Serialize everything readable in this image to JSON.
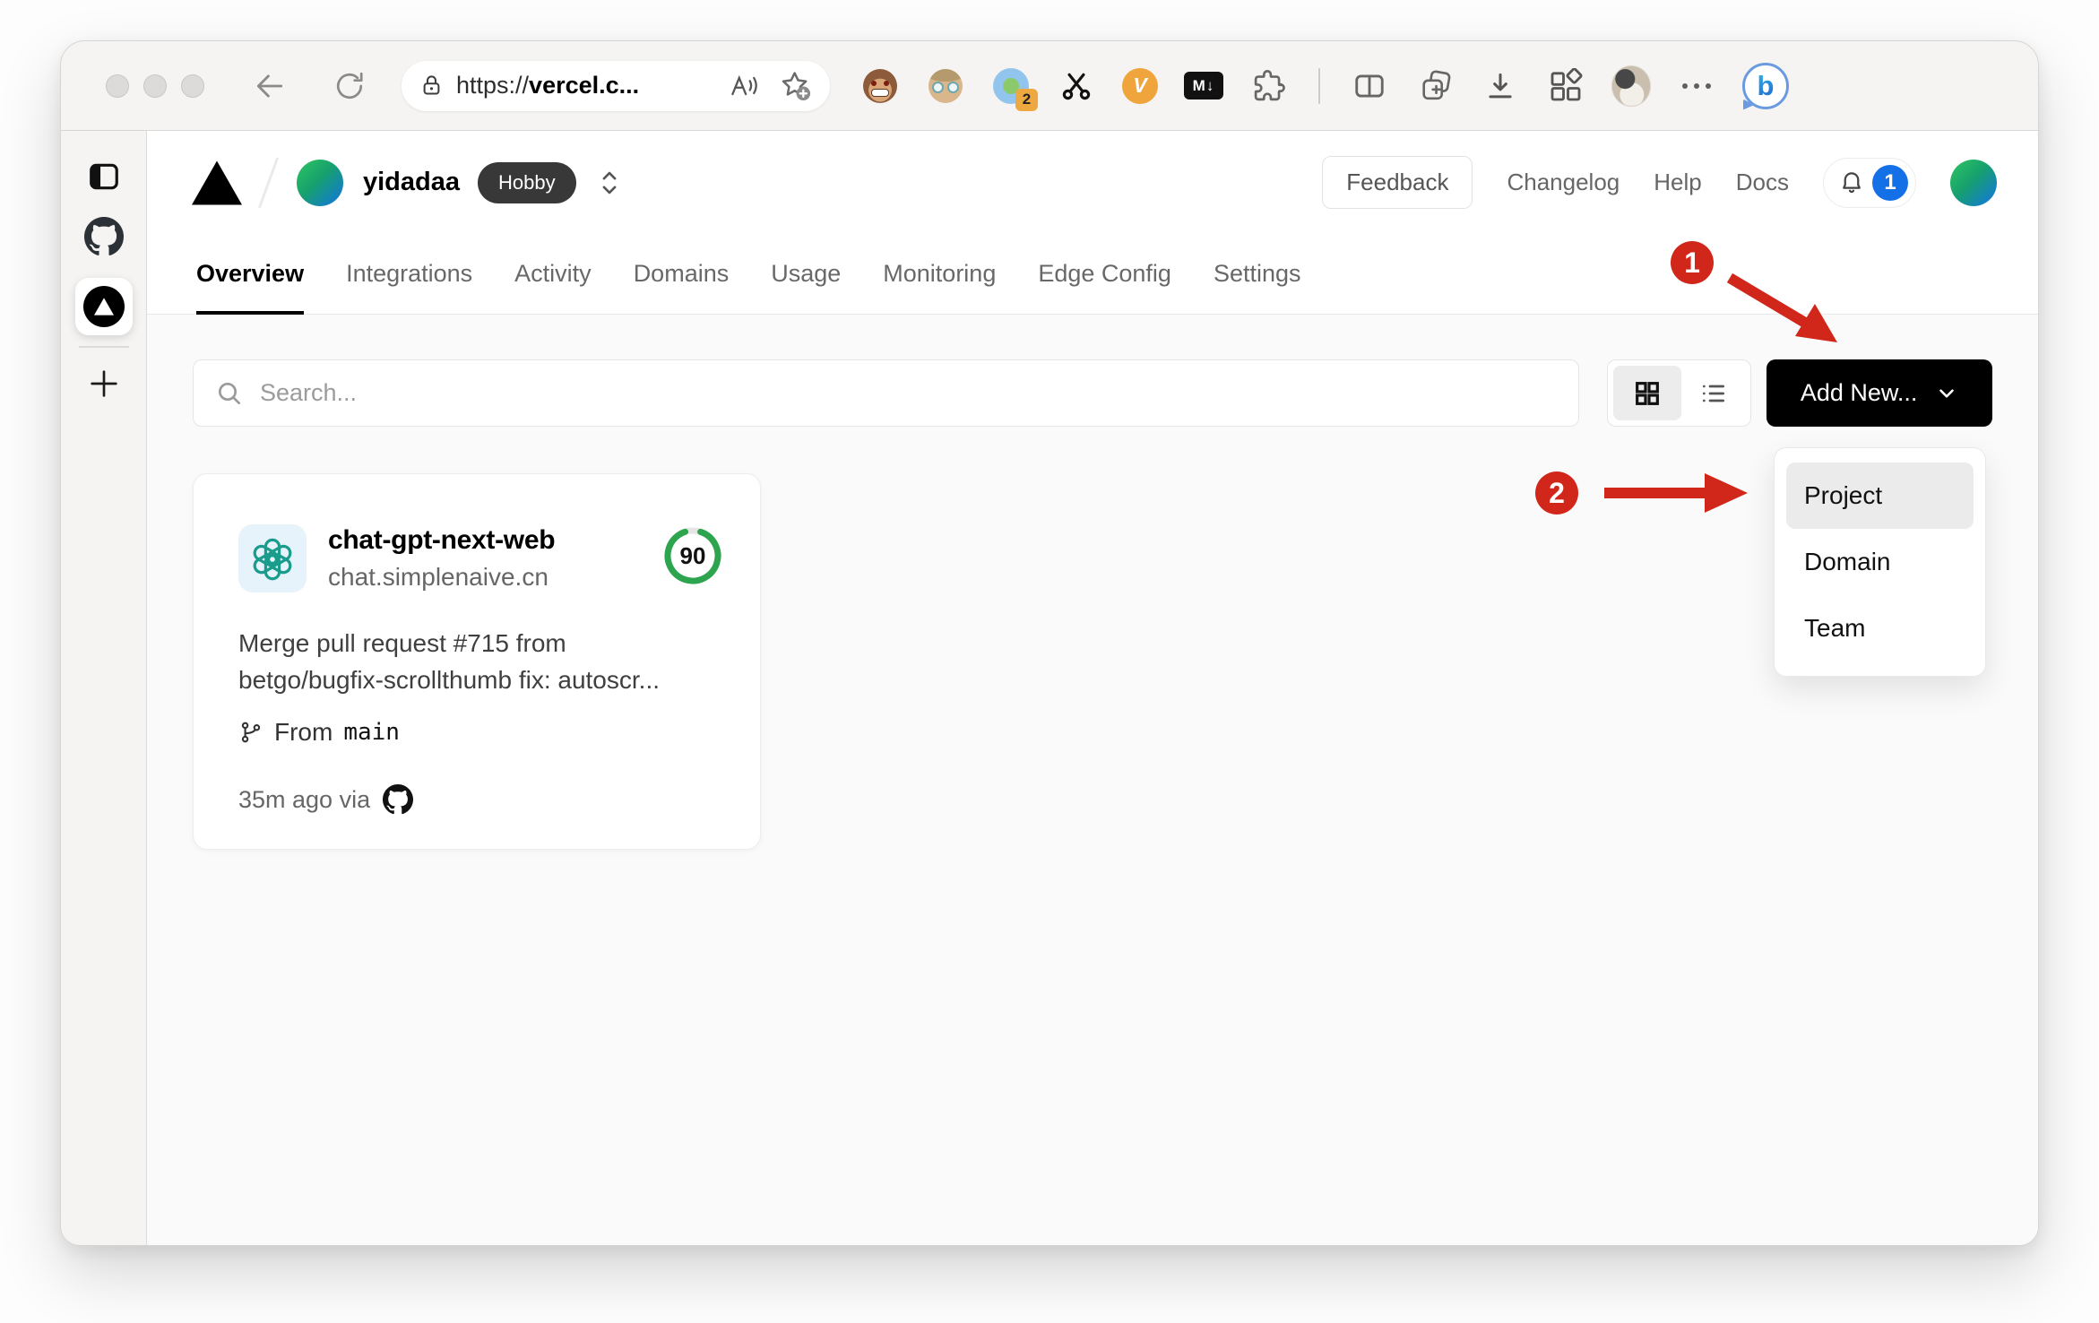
{
  "browser": {
    "address": {
      "scheme": "https://",
      "host": "vercel.c..."
    },
    "extension_badge_count": "2",
    "video_speed_label": "V",
    "markdown_badge_label": "M↓",
    "bing_label": "b"
  },
  "header": {
    "team_name": "yidadaa",
    "plan_badge": "Hobby",
    "feedback_label": "Feedback",
    "links": [
      "Changelog",
      "Help",
      "Docs"
    ],
    "notification_count": "1"
  },
  "tabs": {
    "items": [
      {
        "label": "Overview"
      },
      {
        "label": "Integrations"
      },
      {
        "label": "Activity"
      },
      {
        "label": "Domains"
      },
      {
        "label": "Usage"
      },
      {
        "label": "Monitoring"
      },
      {
        "label": "Edge Config"
      },
      {
        "label": "Settings"
      }
    ],
    "active": "Overview"
  },
  "controls": {
    "search_placeholder": "Search...",
    "add_new_label": "Add New..."
  },
  "dropdown": {
    "items": [
      {
        "label": "Project",
        "highlighted": true
      },
      {
        "label": "Domain",
        "highlighted": false
      },
      {
        "label": "Team",
        "highlighted": false
      }
    ]
  },
  "project_card": {
    "name": "chat-gpt-next-web",
    "domain": "chat.simplenaive.cn",
    "score": "90",
    "commit_line1": "Merge pull request #715 from",
    "commit_line2": "betgo/bugfix-scrollthumb fix: autoscr...",
    "branch_label": "From",
    "branch_name": "main",
    "deployed_text": "35m ago via"
  },
  "annotations": {
    "step1": "1",
    "step2": "2"
  },
  "colors": {
    "annotation_red": "#d1261a",
    "score_green": "#2da44e",
    "notification_blue": "#1470e6",
    "add_new_black": "#000000",
    "plan_badge_bg": "#383838"
  }
}
